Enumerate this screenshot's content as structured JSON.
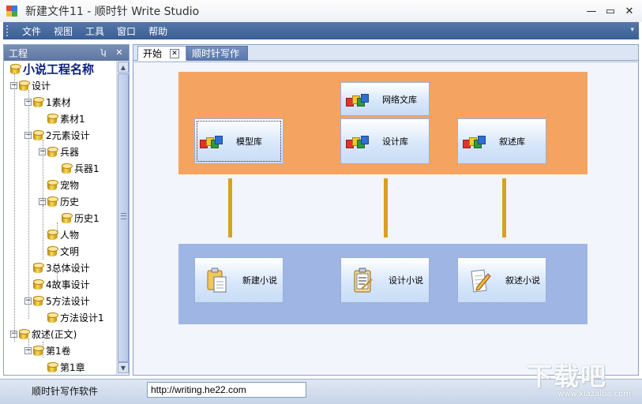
{
  "window": {
    "title": "新建文件11  - 顺时针 Write Studio",
    "controls": {
      "minimize": "—",
      "maximize": "▭",
      "close": "✕"
    }
  },
  "menu": {
    "items": [
      {
        "label": "文件"
      },
      {
        "label": "视图"
      },
      {
        "label": "工具"
      },
      {
        "label": "窗口"
      },
      {
        "label": "帮助"
      }
    ],
    "overflow_arrow": "▾"
  },
  "panel": {
    "title": "工程",
    "pin": "ʮ",
    "close": "✕",
    "tree": [
      {
        "label": "小说工程名称",
        "level": 0,
        "expander": "",
        "root": true
      },
      {
        "label": "设计",
        "level": 1,
        "expander": "−"
      },
      {
        "label": "1素材",
        "level": 2,
        "expander": "−"
      },
      {
        "label": "素材1",
        "level": 3,
        "expander": ""
      },
      {
        "label": "2元素设计",
        "level": 2,
        "expander": "−"
      },
      {
        "label": "兵器",
        "level": 3,
        "expander": "−"
      },
      {
        "label": "兵器1",
        "level": 4,
        "expander": ""
      },
      {
        "label": "宠物",
        "level": 3,
        "expander": ""
      },
      {
        "label": "历史",
        "level": 3,
        "expander": "−"
      },
      {
        "label": "历史1",
        "level": 4,
        "expander": ""
      },
      {
        "label": "人物",
        "level": 3,
        "expander": ""
      },
      {
        "label": "文明",
        "level": 3,
        "expander": ""
      },
      {
        "label": "3总体设计",
        "level": 2,
        "expander": ""
      },
      {
        "label": "4故事设计",
        "level": 2,
        "expander": ""
      },
      {
        "label": "5方法设计",
        "level": 2,
        "expander": "−"
      },
      {
        "label": "方法设计1",
        "level": 3,
        "expander": ""
      },
      {
        "label": "叙述(正文)",
        "level": 1,
        "expander": "−"
      },
      {
        "label": "第1卷",
        "level": 2,
        "expander": "−"
      },
      {
        "label": "第1章",
        "level": 3,
        "expander": ""
      }
    ],
    "scroll_up": "▲",
    "scroll_down": "▼"
  },
  "tabs": [
    {
      "label": "开始",
      "active": true,
      "close": "✕"
    },
    {
      "label": "顺时针写作",
      "active": false
    }
  ],
  "start_page": {
    "top_buttons": [
      {
        "label": "网络文库",
        "icon": "colored-blocks-icon"
      },
      {
        "label": "模型库",
        "icon": "colored-blocks-icon"
      },
      {
        "label": "设计库",
        "icon": "colored-blocks-icon"
      },
      {
        "label": "叙述库",
        "icon": "colored-blocks-icon"
      }
    ],
    "bottom_buttons": [
      {
        "label": "新建小说",
        "icon": "clipboard-new-icon"
      },
      {
        "label": "设计小说",
        "icon": "clipboard-design-icon"
      },
      {
        "label": "叙述小说",
        "icon": "pencil-paper-icon"
      }
    ],
    "colors": {
      "orange": "#f4a460",
      "blue": "#9fb5e4",
      "connector": "#d9a11f"
    }
  },
  "status": {
    "text": "顺时针写作软件",
    "url": "http://writing.he22.com"
  },
  "watermark": {
    "text": "下载吧",
    "url": "www.xiazaiba.com"
  }
}
